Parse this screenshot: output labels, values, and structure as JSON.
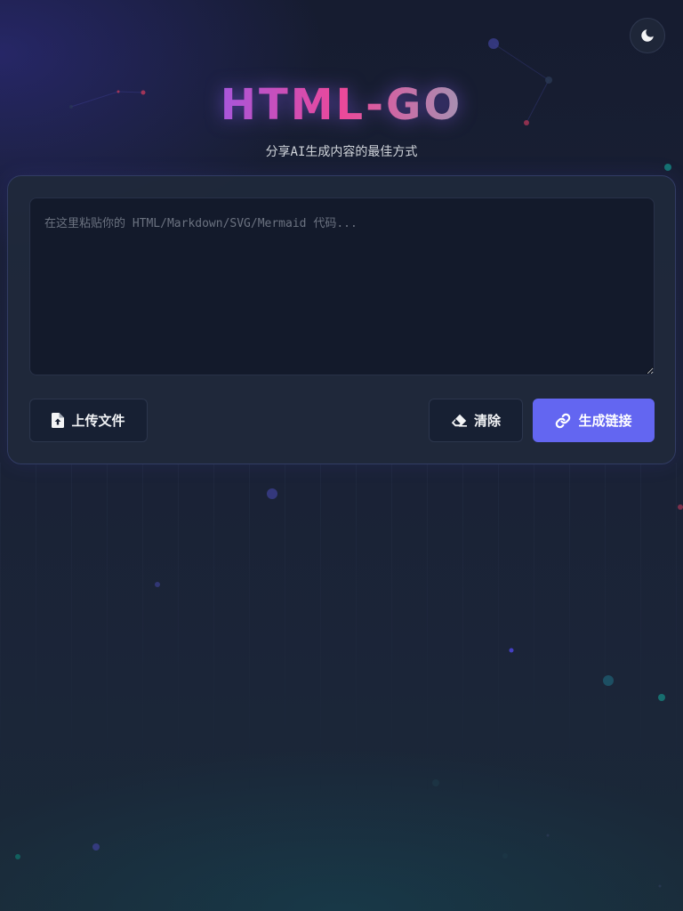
{
  "app": {
    "title": "HTML-GO",
    "subtitle": "分享AI生成内容的最佳方式"
  },
  "theme_toggle": {
    "icon": "moon-icon"
  },
  "editor": {
    "value": "",
    "placeholder": "在这里粘贴你的 HTML/Markdown/SVG/Mermaid 代码..."
  },
  "actions": {
    "upload_label": "上传文件",
    "upload_icon": "file-upload-icon",
    "clear_label": "清除",
    "clear_icon": "eraser-icon",
    "generate_label": "生成链接",
    "generate_icon": "link-icon"
  },
  "colors": {
    "accent": "#6366f1",
    "background": "#1a2135",
    "card": "#1f293b",
    "editor_background": "#131a2b"
  }
}
